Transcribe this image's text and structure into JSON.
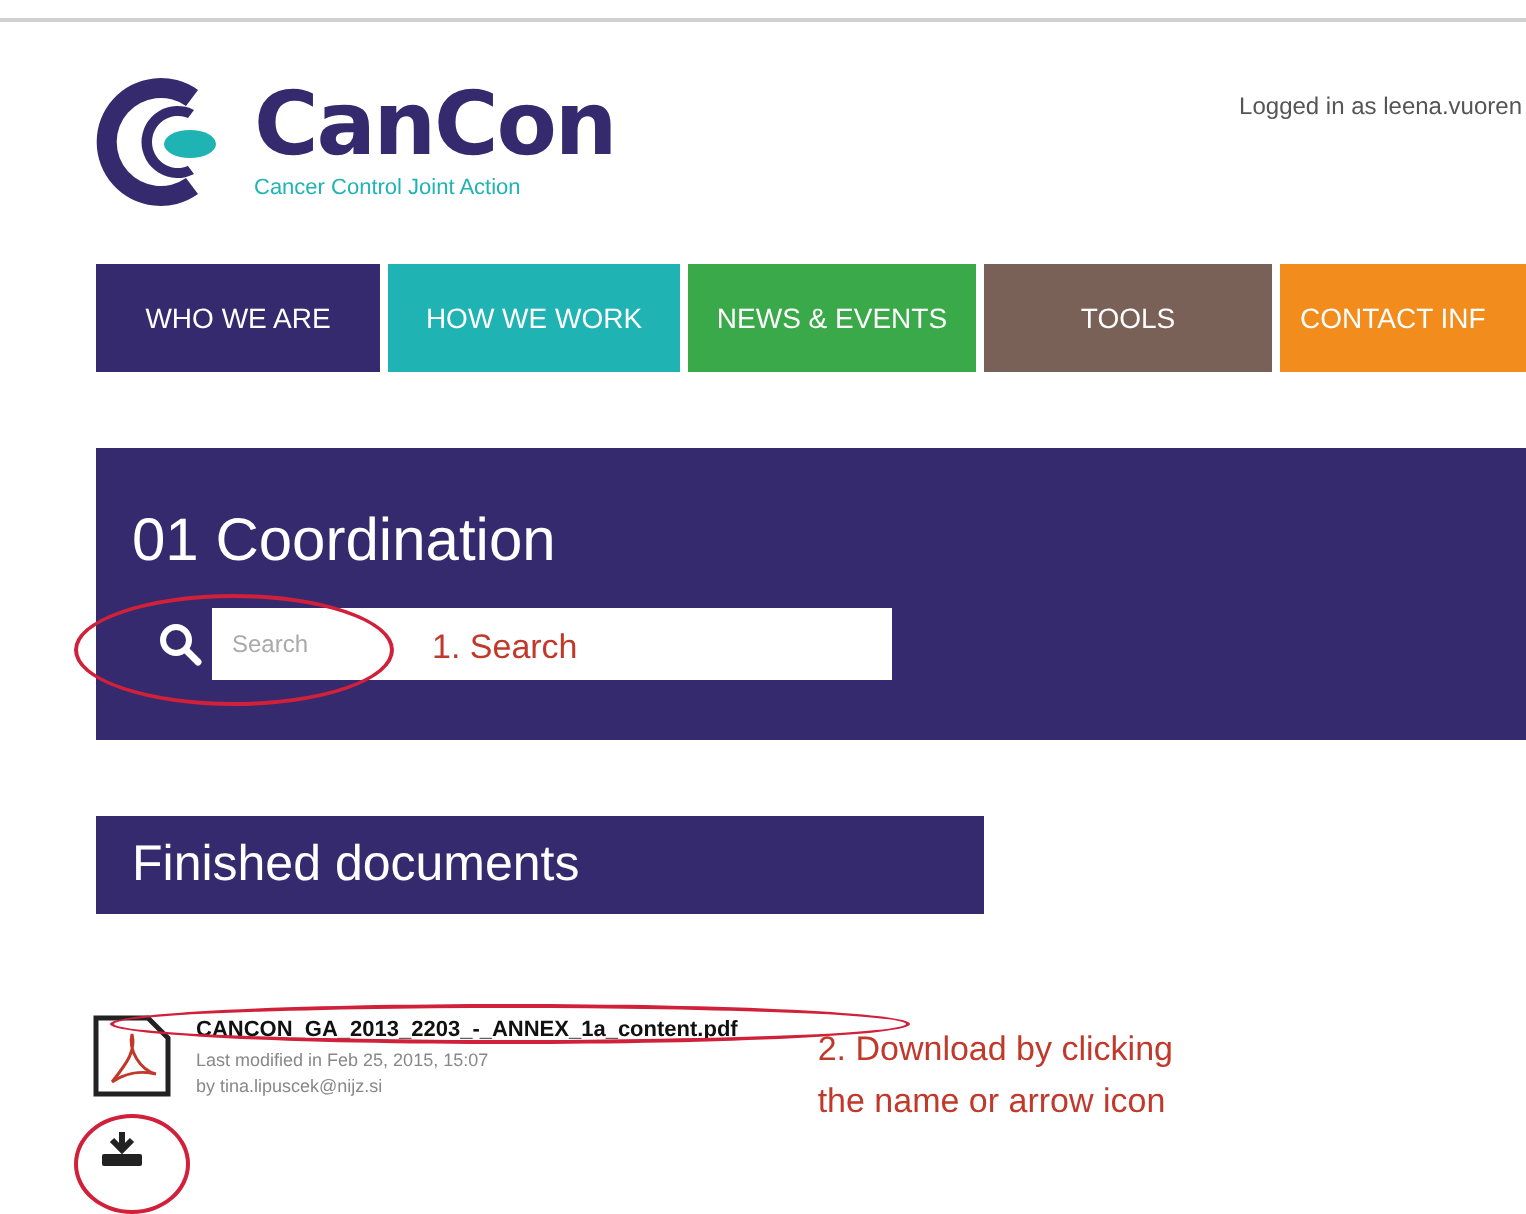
{
  "header": {
    "logo_name": "CanCon",
    "logo_tagline": "Cancer Control Joint Action",
    "user_status": "Logged in as leena.vuoren"
  },
  "nav": [
    {
      "label": "WHO WE ARE",
      "color": "#352a6e"
    },
    {
      "label": "HOW WE WORK",
      "color": "#1fb3b3"
    },
    {
      "label": "NEWS & EVENTS",
      "color": "#3aa94a"
    },
    {
      "label": "TOOLS",
      "color": "#7a6158"
    },
    {
      "label": "CONTACT INF",
      "color": "#f28c1c"
    }
  ],
  "section": {
    "title": "01 Coordination",
    "search": {
      "placeholder": "Search"
    },
    "annotation": "1. Search"
  },
  "documents": {
    "heading": "Finished documents",
    "items": [
      {
        "name": "CANCON_GA_2013_2203_-_ANNEX_1a_content.pdf",
        "modified": "Last modified in Feb 25, 2015, 15:07",
        "author": "by tina.lipuscek@nijz.si"
      }
    ],
    "annotation_lines": [
      "2. Download by clicking",
      "the name or arrow icon"
    ]
  }
}
